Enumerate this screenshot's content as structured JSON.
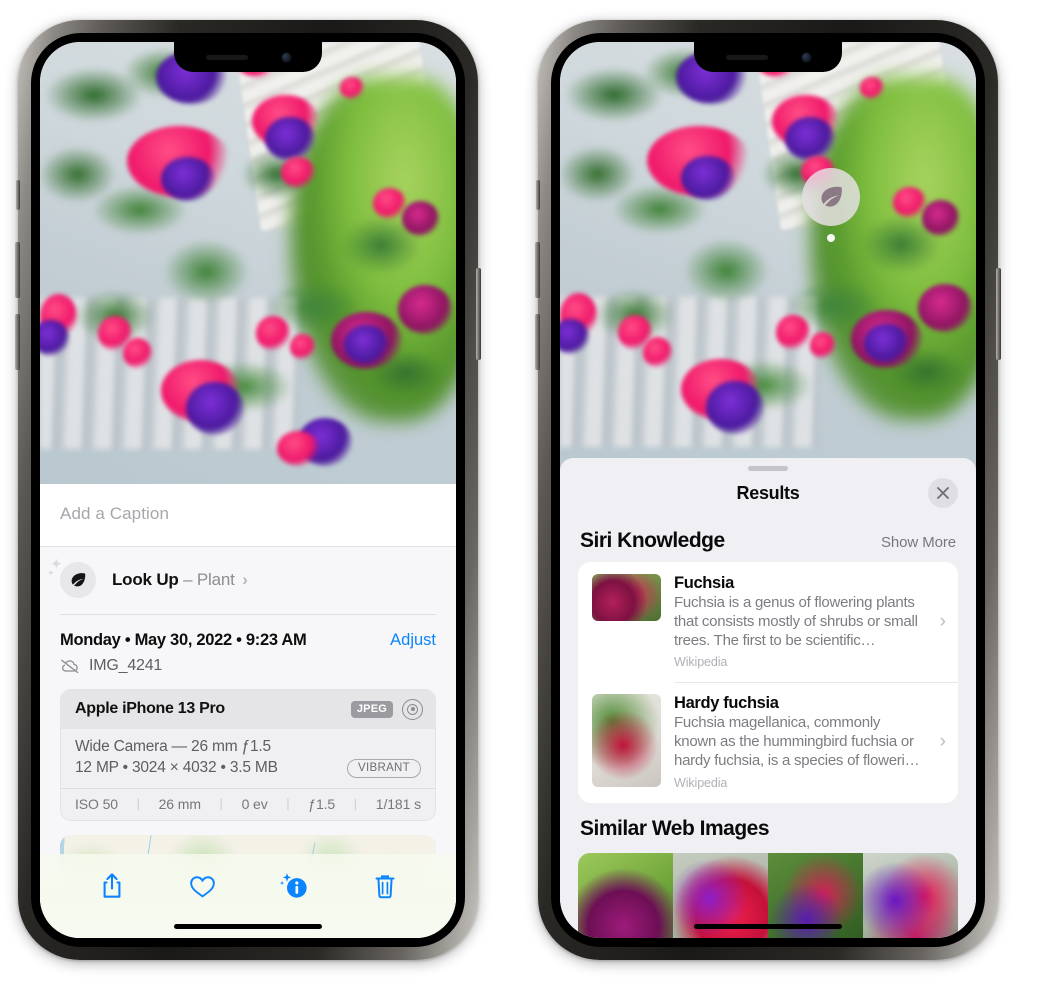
{
  "meta": {
    "app": "Photos",
    "platform": "iOS",
    "device_label": "iPhone 13 Pro",
    "accent_blue": "#0b84ff",
    "sheet_bg": "#f0f0f4",
    "panel_bg": "#f7f7f9"
  },
  "left_phone": {
    "photo": {
      "alt": "Hanging basket of pink and purple fuchsia flowers on a porch"
    },
    "caption": {
      "placeholder": "Add a Caption",
      "value": ""
    },
    "look_up": {
      "icon": "leaf-icon",
      "sparkle": "sparkle-icon",
      "label": "Look Up",
      "dash": "–",
      "subject": "Plant",
      "chevron": "›"
    },
    "date_row": {
      "date_text": "Monday • May 30, 2022 • 9:23 AM",
      "adjust_label": "Adjust"
    },
    "file_row": {
      "icon": "cloud-slash-icon",
      "filename": "IMG_4241"
    },
    "exif": {
      "device": "Apple iPhone 13 Pro",
      "format_badge": "JPEG",
      "raw_icon": "aperture-icon",
      "lens_line": "Wide Camera — 26 mm ƒ1.5",
      "size_line": "12 MP • 3024 × 4032 • 3.5 MB",
      "style_badge": "VIBRANT",
      "stats": [
        "ISO 50",
        "26 mm",
        "0 ev",
        "ƒ1.5",
        "1/181 s"
      ],
      "separator": "|"
    },
    "map": {
      "pin_alt": "photo-location-thumbnail"
    },
    "toolbar": [
      {
        "name": "share-button",
        "icon": "share-icon"
      },
      {
        "name": "favorite-button",
        "icon": "heart-icon"
      },
      {
        "name": "info-button",
        "icon": "info-sparkle-icon"
      },
      {
        "name": "delete-button",
        "icon": "trash-icon"
      }
    ]
  },
  "right_phone": {
    "photo": {
      "alt": "Hanging basket of pink and purple fuchsia flowers on a porch"
    },
    "vlu_badge": {
      "icon": "leaf-icon",
      "label": "Visual Look Up plant indicator"
    },
    "sheet": {
      "grabber": "drag-handle",
      "title": "Results",
      "close_icon": "close-icon"
    },
    "siri_knowledge": {
      "section_title": "Siri Knowledge",
      "show_more": "Show More",
      "items": [
        {
          "title": "Fuchsia",
          "description": "Fuchsia is a genus of flowering plants that consists mostly of shrubs or small trees. The first to be scientific…",
          "source": "Wikipedia",
          "chevron": "›",
          "thumb_alt": "red fuchsia flowers"
        },
        {
          "title": "Hardy fuchsia",
          "description": "Fuchsia magellanica, commonly known as the hummingbird fuchsia or hardy fuchsia, is a species of floweri…",
          "source": "Wikipedia",
          "chevron": "›",
          "thumb_alt": "hardy fuchsia branch specimen"
        }
      ]
    },
    "similar_web_images": {
      "section_title": "Similar Web Images",
      "items": [
        {
          "alt": "pink and magenta fuchsia with leaves"
        },
        {
          "alt": "close-up red fuchsia petals"
        },
        {
          "alt": "fuchsia bush with buds"
        },
        {
          "alt": "purple and red double fuchsia"
        }
      ]
    }
  }
}
